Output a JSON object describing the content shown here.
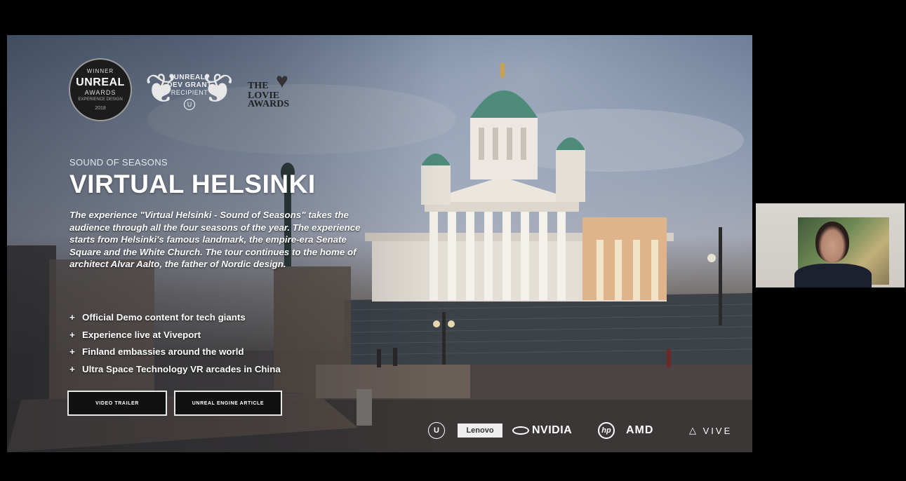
{
  "colors": {
    "background": "#000000",
    "headline": "#ffffff",
    "button_border": "#e8e8e8",
    "button_fill": "#111111"
  },
  "awards": {
    "winner": {
      "line1": "WINNER",
      "line2": "UNREAL",
      "line3": "AWARDS",
      "line4": "EXPERIENCE DESIGN",
      "line5": "2018"
    },
    "grant": {
      "line1": "UNREAL",
      "line2": "DEV GRANT",
      "line3": "RECIPIENT",
      "mark": "U"
    },
    "lovie": {
      "line1": "THE",
      "line2": "LOVIE",
      "line3": "AWARDS"
    }
  },
  "slide": {
    "kicker": "SOUND OF SEASONS",
    "headline": "VIRTUAL HELSINKI",
    "description": "The experience \"Virtual Helsinki - Sound of Seasons\" takes the audience through all the four seasons of the year. The experience starts from Helsinki's famous landmark, the empire-era Senate Square and the White Church. The tour continues to the home of architect Alvar Aalto, the father of Nordic design.",
    "bullets": [
      "Official Demo content for tech giants",
      "Experience live at Viveport",
      "Finland embassies around the world",
      "Ultra Space Technology VR arcades in China"
    ],
    "bullet_marker": "+",
    "buttons": {
      "video": "VIDEO TRAILER",
      "article": "UNREAL ENGINE ARTICLE"
    }
  },
  "sponsors": {
    "unreal": "U",
    "lenovo": "Lenovo",
    "nvidia": "NVIDIA",
    "hp": "hp",
    "amd": "AMD",
    "vive": "VIVE"
  },
  "webcam": {
    "icons": [
      "painting",
      "person"
    ]
  }
}
